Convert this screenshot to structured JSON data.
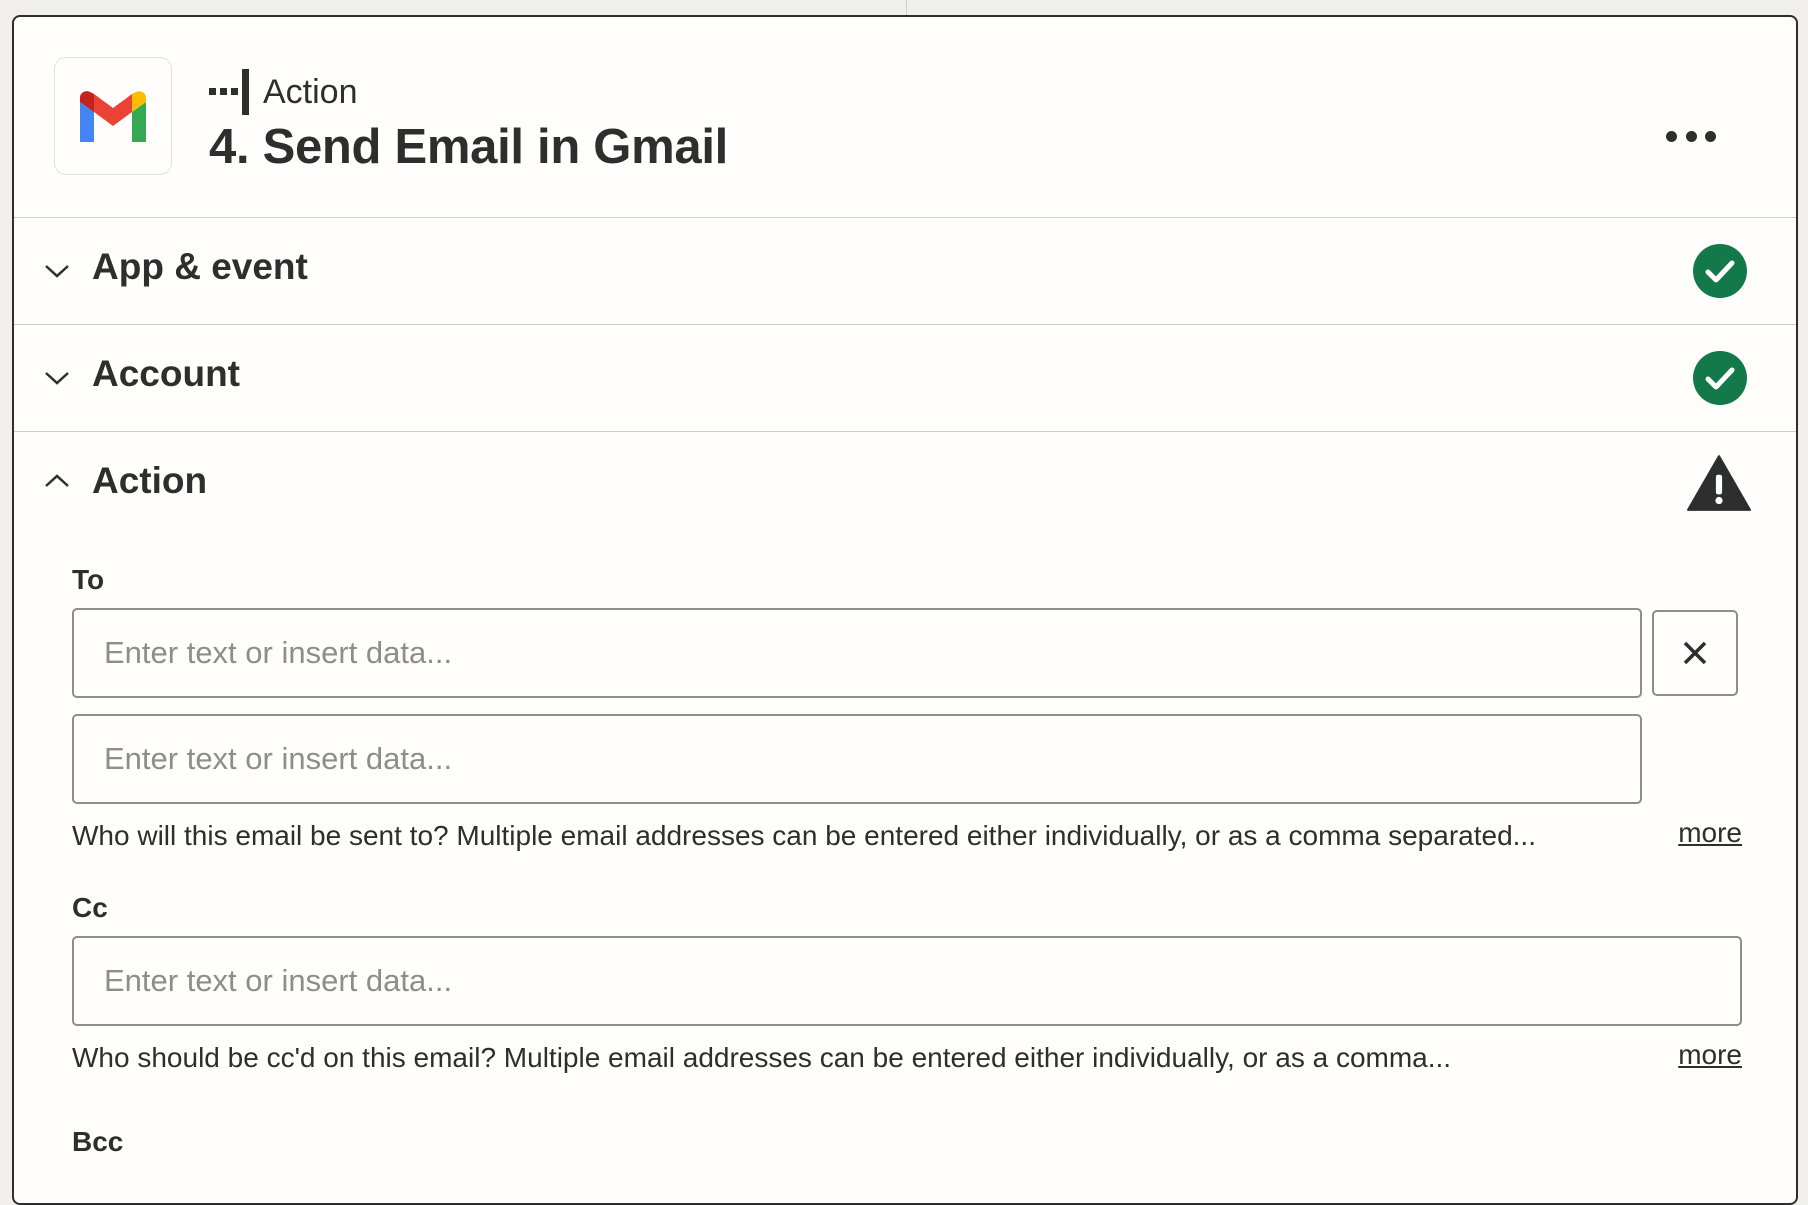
{
  "step": {
    "kind_label": "Action",
    "title": "4. Send Email in Gmail",
    "app_icon": "gmail-logo-icon",
    "kind_icon": "action-step-icon",
    "menu_icon": "more-horizontal-icon"
  },
  "sections": [
    {
      "label": "App & event",
      "state": "collapsed",
      "status": "complete"
    },
    {
      "label": "Account",
      "state": "collapsed",
      "status": "complete"
    },
    {
      "label": "Action",
      "state": "expanded",
      "status": "warning"
    }
  ],
  "fields": {
    "to": {
      "label": "To",
      "inputs": [
        {
          "value": "",
          "placeholder": "Enter text or insert data..."
        },
        {
          "value": "",
          "placeholder": "Enter text or insert data..."
        }
      ],
      "help": "Who will this email be sent to? Multiple email addresses can be entered either individually, or as a comma separated...",
      "more_label": "more"
    },
    "cc": {
      "label": "Cc",
      "input": {
        "value": "",
        "placeholder": "Enter text or insert data..."
      },
      "help": "Who should be cc'd on this email? Multiple email addresses can be entered either individually, or as a comma...",
      "more_label": "more"
    },
    "bcc": {
      "label": "Bcc"
    }
  },
  "colors": {
    "success": "#13794a",
    "warning": "#2d2e2e",
    "text": "#2d2e2e",
    "placeholder": "#8e8d89",
    "panel_bg": "#fffefc",
    "gmail_red": "#ea4335",
    "gmail_blue": "#4285f4",
    "gmail_green": "#34a853",
    "gmail_yellow": "#fbbc04"
  }
}
